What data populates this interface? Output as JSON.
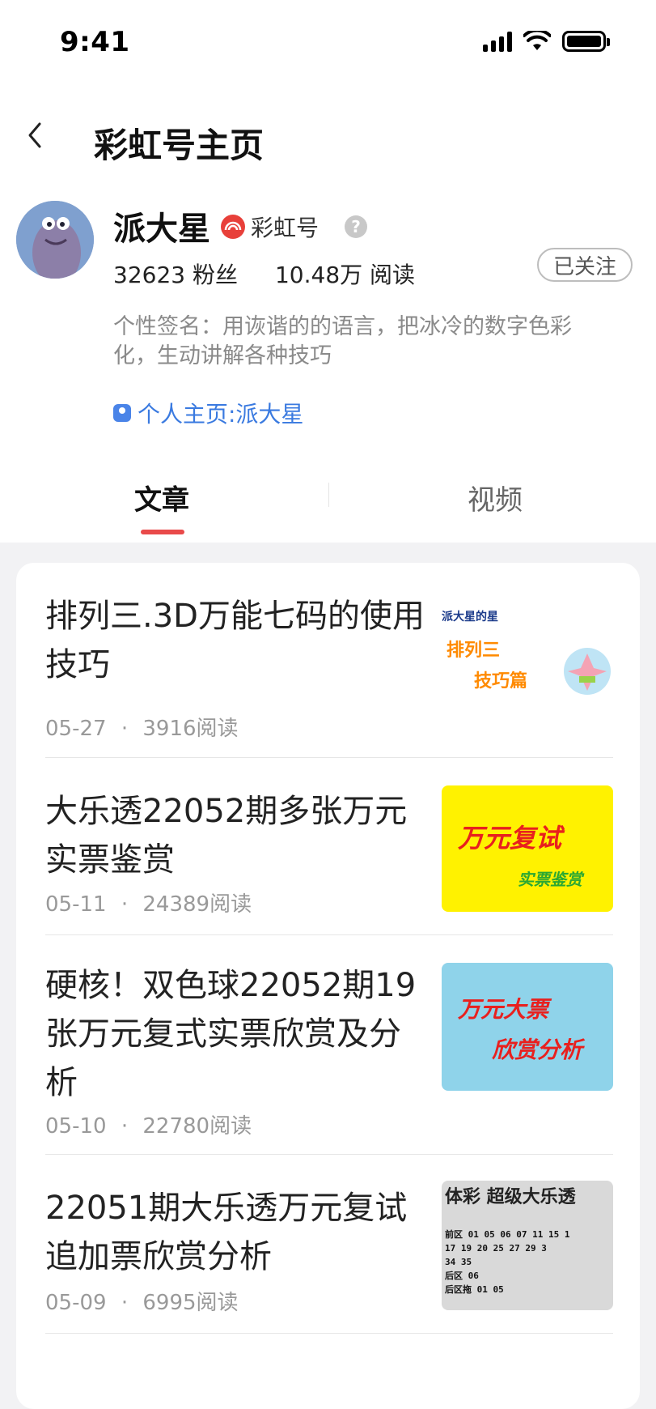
{
  "status": {
    "time": "9:41"
  },
  "nav": {
    "title": "彩虹号主页"
  },
  "profile": {
    "name": "派大星",
    "badge": "彩虹号",
    "help": "?",
    "followers": "32623 粉丝",
    "reads": "10.48万 阅读",
    "follow_label": "已关注",
    "signature": "个性签名：用诙谐的的语言，把冰冷的数字色彩化，生动讲解各种技巧",
    "homepage": "个人主页:派大星"
  },
  "tabs": [
    {
      "label": "文章",
      "active": true
    },
    {
      "label": "视频",
      "active": false
    }
  ],
  "articles": [
    {
      "title": "排列三.3D万能七码的使用技巧",
      "date": "05-27",
      "reads": "3916阅读",
      "thumb": {
        "top_text": "派大星的星",
        "line1": "排列三",
        "line2": "技巧篇",
        "bg": "#ffffff"
      }
    },
    {
      "title": "大乐透22052期多张万元实票鉴赏",
      "date": "05-11",
      "reads": "24389阅读",
      "thumb": {
        "line1": "万元复试",
        "line2": "实票鉴赏",
        "bg": "#fff200"
      }
    },
    {
      "title": "硬核！双色球22052期19张万元复式实票欣赏及分析",
      "date": "05-10",
      "reads": "22780阅读",
      "thumb": {
        "line1": "万元大票",
        "line2": "欣赏分析",
        "bg": "#8fd3ea"
      }
    },
    {
      "title": "22051期大乐透万元复试追加票欣赏分析",
      "date": "05-09",
      "reads": "6995阅读",
      "thumb": {
        "top_text": "体彩 超级大乐透",
        "rows": [
          "前区 01 05 06 07 11 15 1",
          "17 19 20 25 27 29 3",
          "34 35",
          "后区 06",
          "后区拖 01 05"
        ],
        "bg": "#e8e8e8"
      }
    }
  ],
  "separator": "·"
}
